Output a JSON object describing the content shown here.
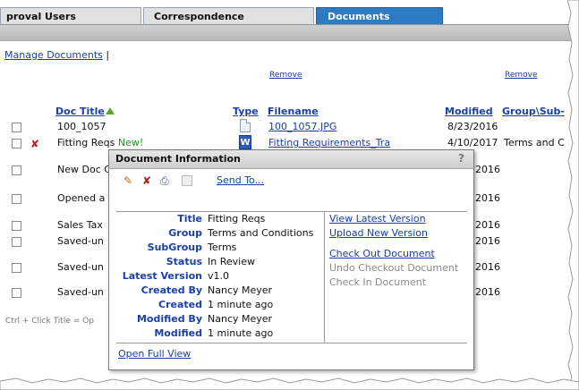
{
  "tabs": [
    {
      "label": "proval Users"
    },
    {
      "label": "Correspondence"
    },
    {
      "label": "Documents"
    }
  ],
  "toolbar": {
    "manage_documents": "Manage Documents",
    "separator": "|"
  },
  "remove_labels": [
    "Remove",
    "Remove"
  ],
  "columns": {
    "doc_title": "Doc Title",
    "type": "Type",
    "filename": "Filename",
    "modified": "Modified",
    "group": "Group\\Sub-"
  },
  "rows": [
    {
      "title": "100_1057",
      "new_tag": "",
      "filename": "100_1057.JPG",
      "modified": "8/23/2016",
      "group": ""
    },
    {
      "title": "Fitting Reqs",
      "new_tag": "New!",
      "filename": "Fitting Requirements_Tra",
      "modified": "4/10/2017",
      "group": "Terms and C"
    },
    {
      "title": "New Doc C",
      "new_tag": "",
      "filename": "",
      "modified": "2016",
      "group": ""
    },
    {
      "title": "Opened a",
      "new_tag": "",
      "filename": "",
      "modified": "2016",
      "group": ""
    },
    {
      "title": "Sales Tax",
      "new_tag": "",
      "filename": "",
      "modified": "2016",
      "group": ""
    },
    {
      "title": "Saved-un",
      "new_tag": "",
      "filename": "",
      "modified": "2016",
      "group": ""
    },
    {
      "title": "Saved-un",
      "new_tag": "",
      "filename": "",
      "modified": "2016",
      "group": ""
    },
    {
      "title": "Saved-un",
      "new_tag": "",
      "filename": "",
      "modified": "2016",
      "group": ""
    }
  ],
  "hint": "Ctrl + Click Title = Op",
  "popup": {
    "title": "Document Information",
    "help": "?",
    "send_to": "Send To...",
    "fields": [
      {
        "label": "Title",
        "value": "Fitting Reqs"
      },
      {
        "label": "Group",
        "value": "Terms and Conditions"
      },
      {
        "label": "SubGroup",
        "value": "Terms"
      },
      {
        "label": "Status",
        "value": "In Review"
      },
      {
        "label": "Latest Version",
        "value": "v1.0"
      },
      {
        "label": "Created By",
        "value": "Nancy Meyer"
      },
      {
        "label": "Created",
        "value": "1 minute ago"
      },
      {
        "label": "Modified By",
        "value": "Nancy Meyer"
      },
      {
        "label": "Modified",
        "value": "1 minute ago"
      }
    ],
    "actions": {
      "view_latest": "View Latest Version",
      "upload_new": "Upload New Version",
      "check_out": "Check Out Document",
      "undo_checkout": "Undo Checkout Document",
      "check_in": "Check In Document"
    },
    "open_full_view": "Open Full View"
  },
  "colors": {
    "active_tab": "#2e7bc4",
    "link": "#1a3fa8",
    "new_tag": "#2e8b2e",
    "delete": "#b21c1c"
  }
}
